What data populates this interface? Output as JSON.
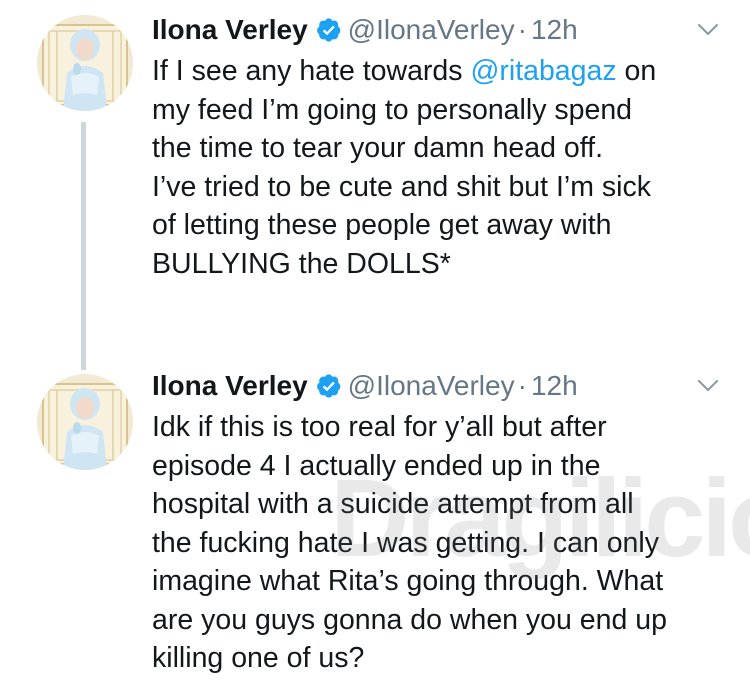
{
  "tweets": [
    {
      "author_name": "Ilona Verley",
      "handle": "@IlonaVerley",
      "separator": "·",
      "time": "12h",
      "lines": [
        {
          "before": "If I see any hate towards ",
          "mention": "@ritabagaz",
          "after": " on"
        },
        {
          "text": "my feed I’m going to personally spend"
        },
        {
          "text": "the time to tear your damn head off."
        },
        {
          "text": "I’ve tried to be cute and shit but I’m sick"
        },
        {
          "text": "of letting these people get away with"
        },
        {
          "text": "BULLYING the DOLLS*"
        }
      ]
    },
    {
      "author_name": "Ilona Verley",
      "handle": "@IlonaVerley",
      "separator": "·",
      "time": "12h",
      "lines": [
        {
          "text": "Idk if this is too real for y’all but after"
        },
        {
          "text": "episode 4 I actually ended up in the"
        },
        {
          "text": "hospital with a suicide attempt from all"
        },
        {
          "text": "the fucking hate I was getting. I can only"
        },
        {
          "text": "imagine what Rita’s going through. What"
        },
        {
          "text": "are you guys gonna do when you end up"
        },
        {
          "text": "killing one of us?"
        }
      ]
    }
  ],
  "watermark": "Dragilicious",
  "colors": {
    "text": "#14171a",
    "secondary": "#657786",
    "link": "#1da1f2",
    "verified": "#1da1f2",
    "thread_line": "#ccd6dd"
  },
  "icons": {
    "verified": "verified-badge-icon",
    "chevron": "chevron-down-icon"
  }
}
